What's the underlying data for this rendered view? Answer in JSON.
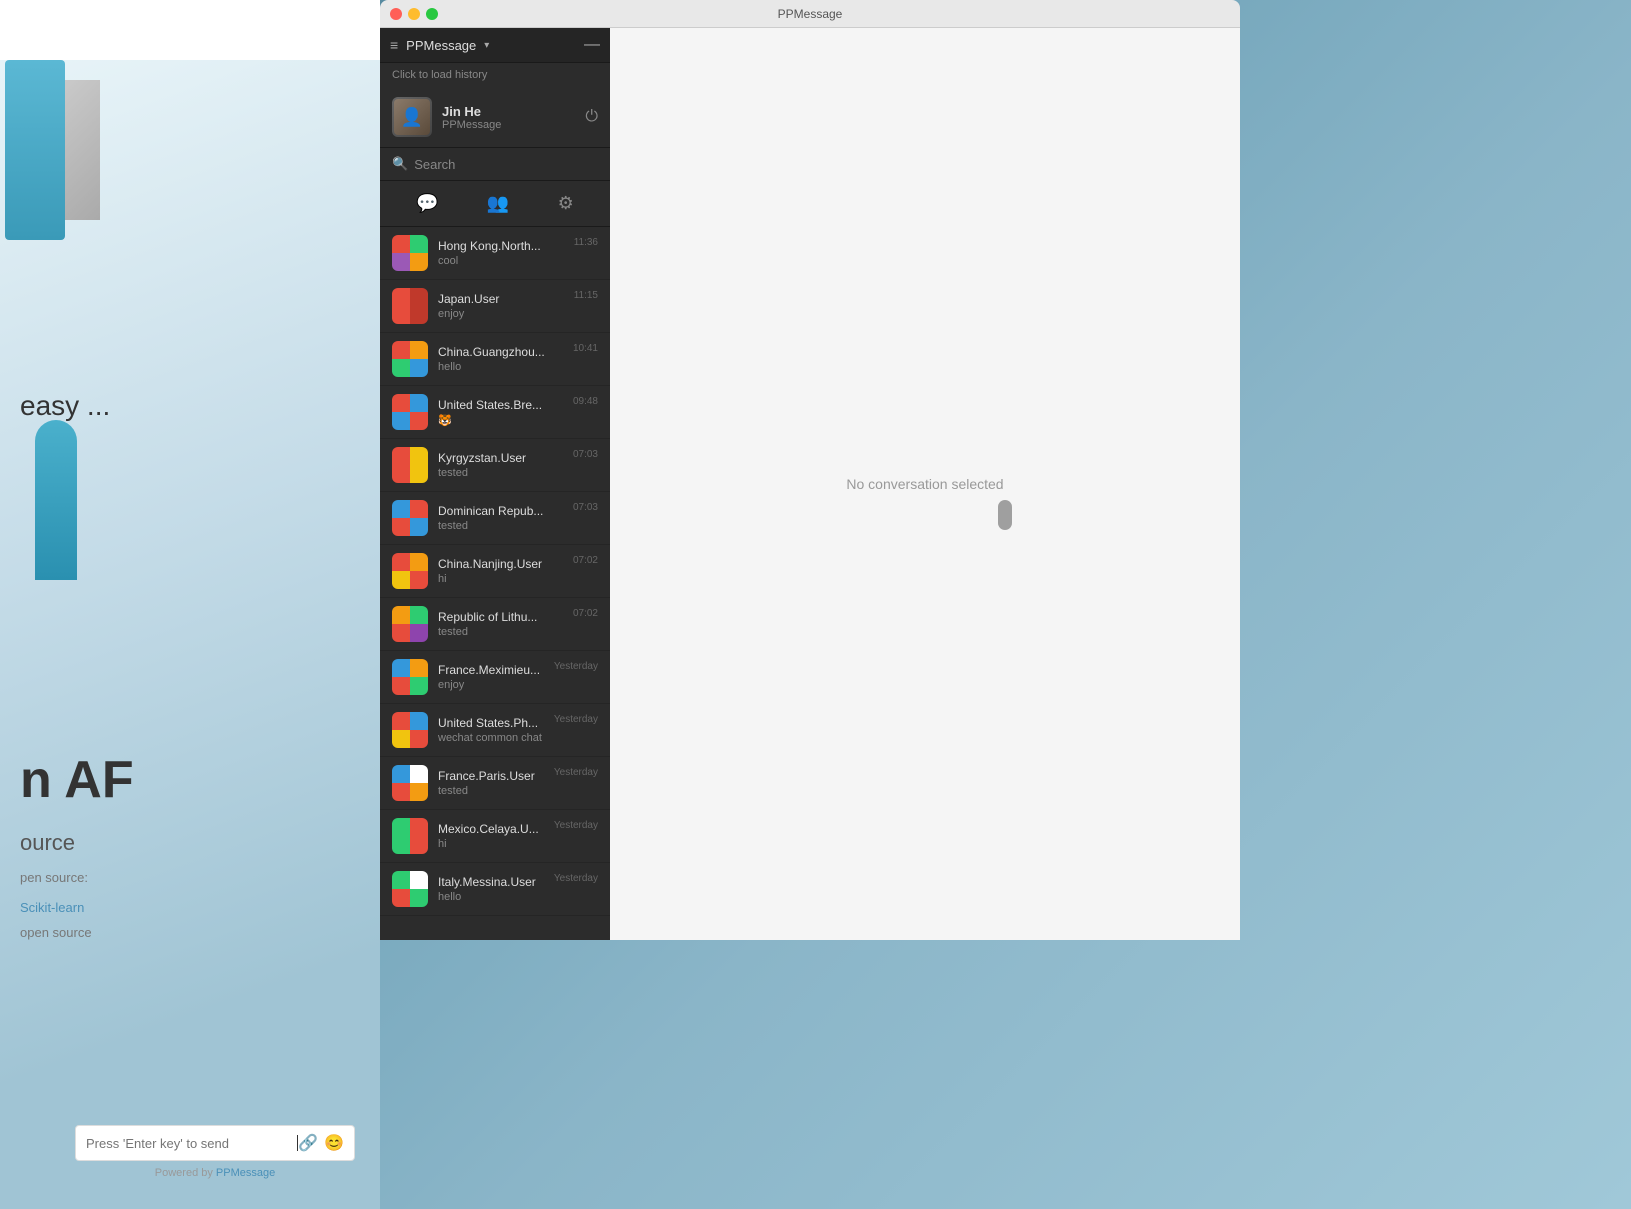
{
  "app": {
    "title": "PPMessage",
    "window_title": "PPMessage"
  },
  "titlebar": {
    "title": "PPMessage",
    "close_btn": "close",
    "minimize_btn": "minimize",
    "maximize_btn": "maximize"
  },
  "sidebar": {
    "menu_icon": "≡",
    "app_name": "PPMessage",
    "chevron": "▾",
    "minimize": "—",
    "history_text": "Click to load history"
  },
  "profile": {
    "name": "Jin He",
    "company": "PPMessage",
    "avatar_icon": "👤",
    "power_icon": "⏻"
  },
  "search": {
    "placeholder": "Search",
    "icon": "🔍"
  },
  "tabs": [
    {
      "id": "chat",
      "icon": "💬",
      "active": true
    },
    {
      "id": "contacts",
      "icon": "👥",
      "active": false
    },
    {
      "id": "settings",
      "icon": "⚙",
      "active": false
    }
  ],
  "conversations": [
    {
      "id": 1,
      "name": "Hong Kong.North...",
      "preview": "cool",
      "time": "11:36",
      "avatar_class": "av-hk"
    },
    {
      "id": 2,
      "name": "Japan.User",
      "preview": "enjoy",
      "time": "11:15",
      "avatar_class": "av-jp"
    },
    {
      "id": 3,
      "name": "China.Guangzhou...",
      "preview": "hello",
      "time": "10:41",
      "avatar_class": "av-cn"
    },
    {
      "id": 4,
      "name": "United States.Bre...",
      "preview": "🐯",
      "time": "09:48",
      "avatar_class": "av-us"
    },
    {
      "id": 5,
      "name": "Kyrgyzstan.User",
      "preview": "tested",
      "time": "07:03",
      "avatar_class": "av-kg"
    },
    {
      "id": 6,
      "name": "Dominican Repub...",
      "preview": "tested",
      "time": "07:03",
      "avatar_class": "av-dr"
    },
    {
      "id": 7,
      "name": "China.Nanjing.User",
      "preview": "hi",
      "time": "07:02",
      "avatar_class": "av-cn2"
    },
    {
      "id": 8,
      "name": "Republic of Lithu...",
      "preview": "tested",
      "time": "07:02",
      "avatar_class": "av-lt"
    },
    {
      "id": 9,
      "name": "France.Meximieu...",
      "preview": "enjoy",
      "time": "Yesterday",
      "avatar_class": "av-fr"
    },
    {
      "id": 10,
      "name": "United States.Ph...",
      "preview": "wechat common chat",
      "time": "Yesterday",
      "avatar_class": "av-us2"
    },
    {
      "id": 11,
      "name": "France.Paris.User",
      "preview": "tested",
      "time": "Yesterday",
      "avatar_class": "av-fr2"
    },
    {
      "id": 12,
      "name": "Mexico.Celaya.U...",
      "preview": "hi",
      "time": "Yesterday",
      "avatar_class": "av-mx"
    },
    {
      "id": 13,
      "name": "Italy.Messina.User",
      "preview": "hello",
      "time": "Yesterday",
      "avatar_class": "av-it"
    }
  ],
  "main_area": {
    "no_conversation": "No conversation selected"
  },
  "input": {
    "placeholder": "Press 'Enter key' to send",
    "powered_by": "Powered by ",
    "powered_by_link": "PPMessage"
  },
  "left_panel": {
    "easy_text": "easy ...",
    "af_text": "n AF",
    "open_source": "ource",
    "source_label": "pen source:",
    "scikit_link": "Scikit-learn",
    "open2": "open source"
  }
}
